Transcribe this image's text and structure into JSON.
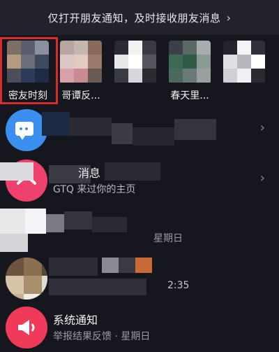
{
  "banner": {
    "text": "仅打开朋友通知，及时接收朋友消息",
    "chevron": "chevron-right-icon"
  },
  "friends": [
    {
      "name": "密友时刻",
      "highlighted": true
    },
    {
      "name": "哥谭反..."
    },
    {
      "name": ""
    },
    {
      "name": "春天里..."
    },
    {
      "name": ""
    }
  ],
  "messages": [
    {
      "title": "",
      "subtitle": "",
      "chevron": "chevron-right-icon",
      "icon": "chat-bubble-icon"
    },
    {
      "title": "消息",
      "subtitle": "GTQ 来过你的主页",
      "chevron": "chevron-right-icon",
      "icon": "visitor-icon"
    },
    {
      "title": "",
      "subtitle": "星期日",
      "icon": ""
    },
    {
      "title": "",
      "subtitle": "2:35",
      "icon": ""
    },
    {
      "title": "系统通知",
      "subtitle": "举报结果反馈 · 星期日",
      "icon": "megaphone-icon"
    }
  ],
  "colors": {
    "background": "#16161e",
    "banner": "#22222b",
    "highlight": "#d92b2b",
    "blue_icon": "#3b8ff0",
    "pink_icon": "#f0406e"
  }
}
